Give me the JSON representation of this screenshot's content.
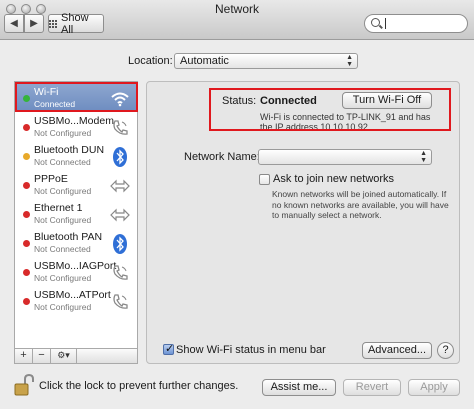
{
  "window": {
    "title": "Network"
  },
  "toolbar": {
    "back": "◀",
    "forward": "▶",
    "show_all": "Show All",
    "search_placeholder": ""
  },
  "location": {
    "label": "Location:",
    "value": "Automatic"
  },
  "services": [
    {
      "name": "Wi-Fi",
      "status": "Connected",
      "dot": "#35b43a",
      "icon": "wifi-icon"
    },
    {
      "name": "USBMo...Modem",
      "status": "Not Configured",
      "dot": "#d82a2a",
      "icon": "phone-icon"
    },
    {
      "name": "Bluetooth DUN",
      "status": "Not Connected",
      "dot": "#e8a92a",
      "icon": "bluetooth-icon"
    },
    {
      "name": "PPPoE",
      "status": "Not Configured",
      "dot": "#d82a2a",
      "icon": "arrows-icon"
    },
    {
      "name": "Ethernet 1",
      "status": "Not Configured",
      "dot": "#d82a2a",
      "icon": "arrows-icon"
    },
    {
      "name": "Bluetooth PAN",
      "status": "Not Connected",
      "dot": "#d82a2a",
      "icon": "bluetooth-icon"
    },
    {
      "name": "USBMo...IAGPort",
      "status": "Not Configured",
      "dot": "#d82a2a",
      "icon": "phone-icon"
    },
    {
      "name": "USBMo...ATPort",
      "status": "Not Configured",
      "dot": "#d82a2a",
      "icon": "phone-icon"
    }
  ],
  "sidebar_controls": {
    "add": "+",
    "remove": "−",
    "action": "⚙▾"
  },
  "status": {
    "label": "Status:",
    "value": "Connected",
    "button": "Turn Wi-Fi Off",
    "description": "Wi-Fi is connected to TP-LINK_91 and has the IP address 10.10.10.92."
  },
  "network_name": {
    "label": "Network Name:",
    "value": ""
  },
  "ask_join": {
    "label": "Ask to join new networks",
    "checked": false,
    "description": "Known networks will be joined automatically. If no known networks are available, you will have to manually select a network."
  },
  "show_status": {
    "label": "Show Wi-Fi status in menu bar",
    "checked": true
  },
  "buttons": {
    "advanced": "Advanced...",
    "help": "?",
    "assist": "Assist me...",
    "revert": "Revert",
    "apply": "Apply"
  },
  "lock": {
    "text": "Click the lock to prevent further changes."
  },
  "colors": {
    "highlight": "#e0181e",
    "selection": "#7b97c8"
  }
}
